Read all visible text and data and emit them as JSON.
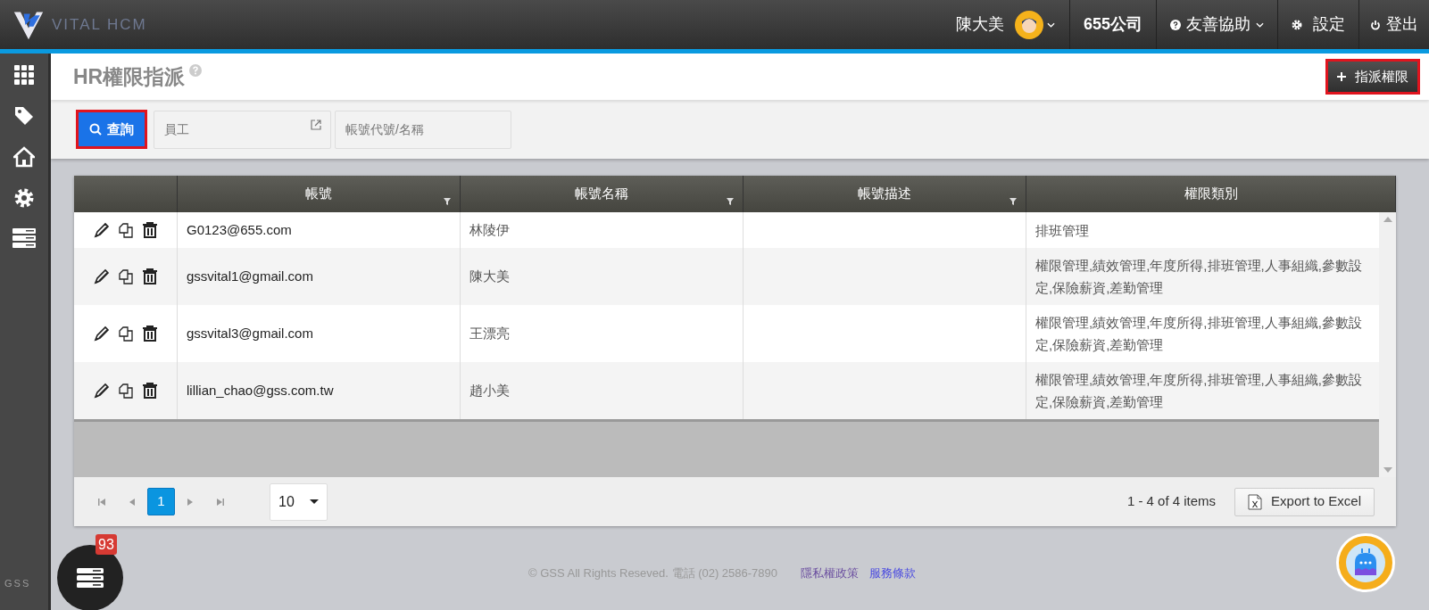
{
  "header": {
    "logo_text": "VITAL HCM",
    "user_name": "陳大美",
    "company": "655公司",
    "help": "友善協助",
    "settings": "設定",
    "logout": "登出"
  },
  "page": {
    "title": "HR權限指派",
    "assign_button": "指派權限"
  },
  "filters": {
    "search_button": "查詢",
    "employee": {
      "placeholder": "員工"
    },
    "account": {
      "placeholder": "帳號代號/名稱"
    }
  },
  "table": {
    "columns": [
      {
        "label": "帳號",
        "filter": true
      },
      {
        "label": "帳號名稱",
        "filter": true
      },
      {
        "label": "帳號描述",
        "filter": true
      },
      {
        "label": "權限類別",
        "filter": false
      }
    ],
    "rows": [
      {
        "account": "G0123@655.com",
        "name": "林陵伊",
        "roles": "排班管理"
      },
      {
        "account": "gssvital1@gmail.com",
        "name": "陳大美",
        "roles": "權限管理,績效管理,年度所得,排班管理,人事組織,參數設定,保險薪資,差勤管理"
      },
      {
        "account": "gssvital3@gmail.com",
        "name": "王漂亮",
        "roles": "權限管理,績效管理,年度所得,排班管理,人事組織,參數設定,保險薪資,差勤管理"
      },
      {
        "account": "lillian_chao@gss.com.tw",
        "name": "趙小美",
        "roles": "權限管理,績效管理,年度所得,排班管理,人事組織,參數設定,保險薪資,差勤管理"
      }
    ]
  },
  "pager": {
    "pages": [
      {
        "label": "1",
        "selected": true
      }
    ],
    "page_size": "10",
    "summary": "1 - 4 of 4 items",
    "export": "Export to Excel"
  },
  "notifications": {
    "count": "93"
  },
  "footer": {
    "copyright": "© GSS All Rights Reseved. 電話 (02) 2586-7890",
    "links": [
      {
        "label": "隱私權政策",
        "color": "#6b4fa0"
      },
      {
        "label": "服務條款",
        "color": "#4a4ae0"
      }
    ],
    "brand": "GSS"
  }
}
